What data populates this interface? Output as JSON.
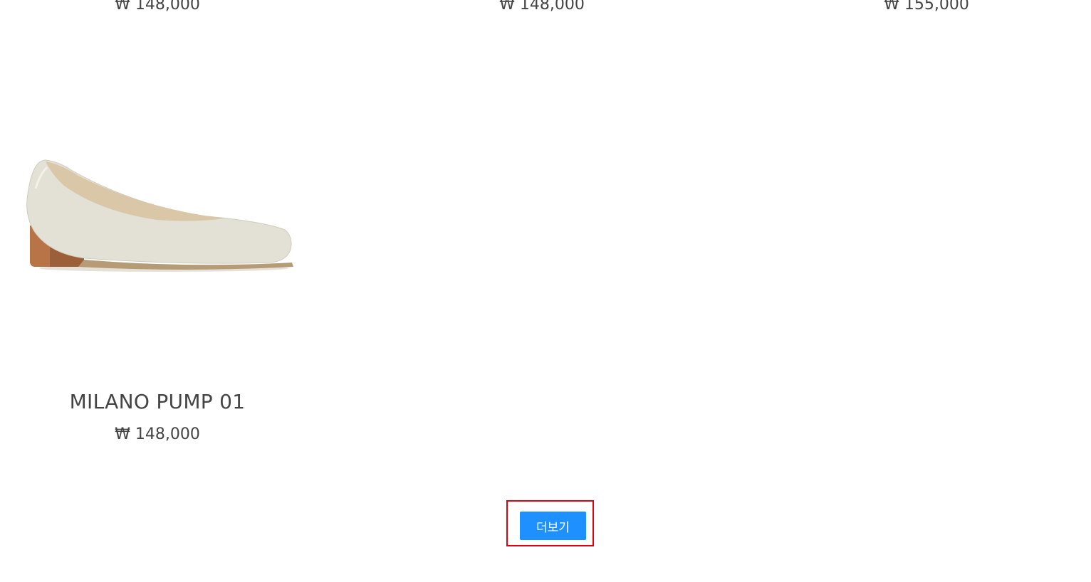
{
  "products_top_row": [
    {
      "price": "₩ 148,000"
    },
    {
      "price": "₩ 148,000"
    },
    {
      "price": "₩ 155,000"
    }
  ],
  "featured_product": {
    "name": "MILANO PUMP 01",
    "price": "₩ 148,000",
    "image": "beige-pump-shoe-image"
  },
  "load_more": {
    "label": "더보기",
    "color": "#1e90ff",
    "highlight_color": "#e3000f"
  }
}
